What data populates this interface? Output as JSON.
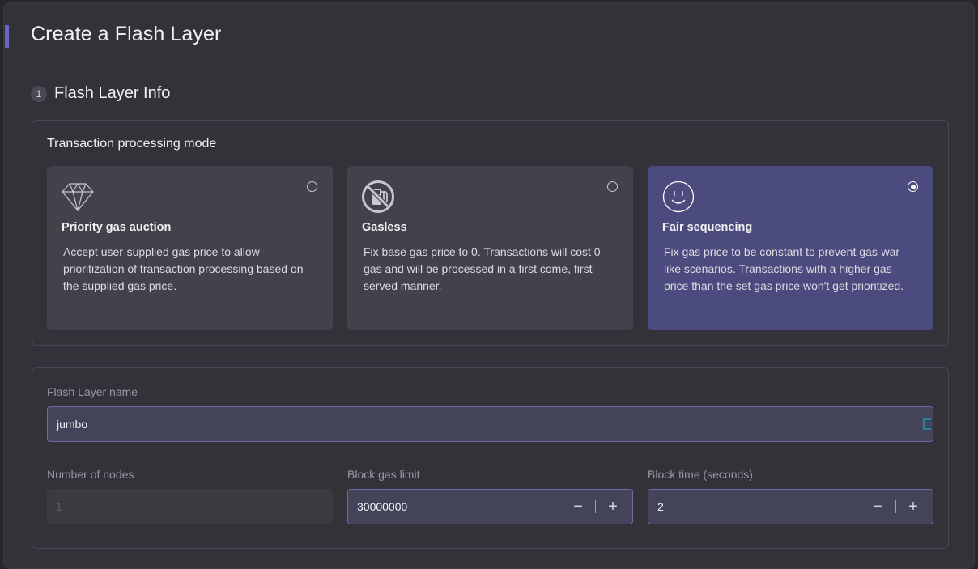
{
  "page": {
    "title": "Create a Flash Layer",
    "accent_color": "#6b63c7"
  },
  "step": {
    "number": "1",
    "title": "Flash Layer Info"
  },
  "mode": {
    "heading": "Transaction processing mode",
    "selected": "Fair sequencing",
    "options": [
      {
        "icon": "diamond-icon",
        "title": "Priority gas auction",
        "description": "Accept user-supplied gas price to allow prioritization of transaction processing based on the supplied gas price.",
        "selected": false
      },
      {
        "icon": "no-gas-icon",
        "title": "Gasless",
        "description": "Fix base gas price to 0. Transactions will cost 0 gas and will be processed in a first come, first served manner.",
        "selected": false
      },
      {
        "icon": "smiley-icon",
        "title": "Fair sequencing",
        "description": "Fix gas price to be constant to prevent gas-war like scenarios. Transactions with a higher gas price than the set gas price won't get prioritized.",
        "selected": true
      }
    ]
  },
  "form": {
    "name_label": "Flash Layer name",
    "name_value": "jumbo",
    "nodes_label": "Number of nodes",
    "nodes_value": "1",
    "gas_label": "Block gas limit",
    "gas_value": "30000000",
    "time_label": "Block time (seconds)",
    "time_value": "2",
    "decrement_symbol": "−",
    "increment_symbol": "+"
  }
}
